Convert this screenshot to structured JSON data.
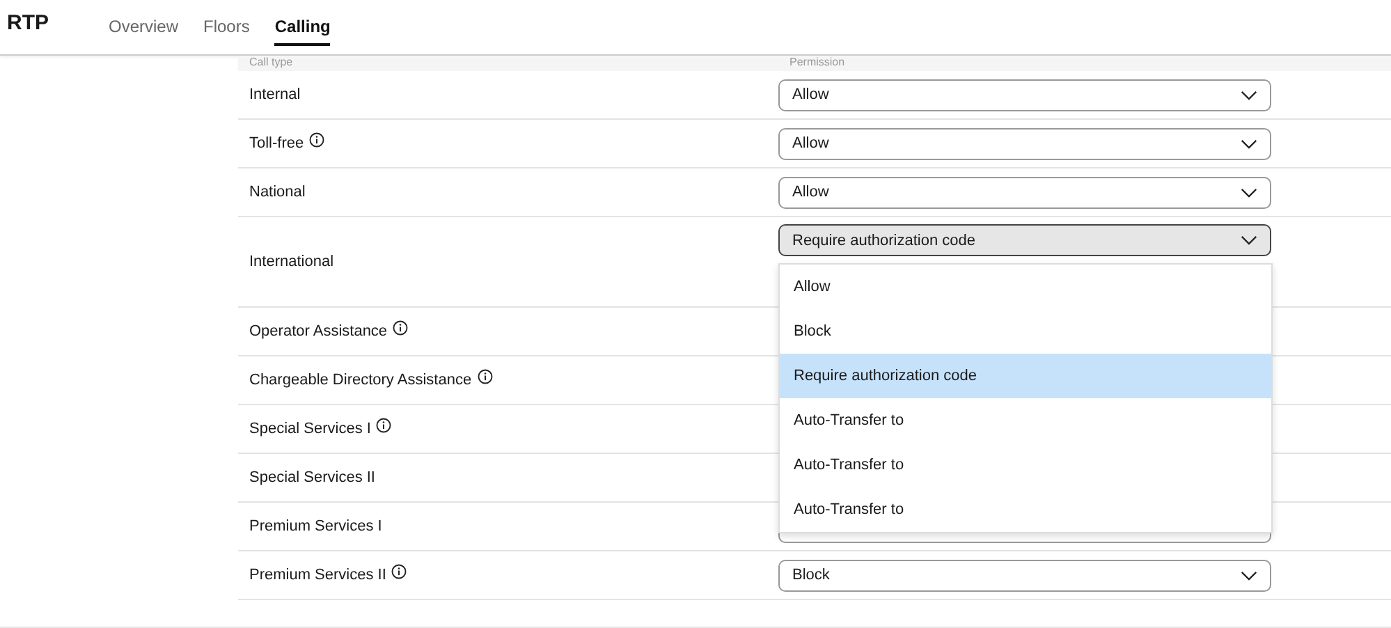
{
  "header": {
    "title": "RTP",
    "tabs": [
      {
        "label": "Overview",
        "selected": false
      },
      {
        "label": "Floors",
        "selected": false
      },
      {
        "label": "Calling",
        "selected": true
      }
    ]
  },
  "table": {
    "columns": [
      "Call type",
      "Permission"
    ],
    "rows": [
      {
        "call_type": "Internal",
        "info": false,
        "permission": "Allow"
      },
      {
        "call_type": "Toll-free",
        "info": true,
        "permission": "Allow"
      },
      {
        "call_type": "National",
        "info": false,
        "permission": "Allow"
      },
      {
        "call_type": "International",
        "info": false,
        "permission": "Require authorization code",
        "expanded": true,
        "options": [
          {
            "label": "Allow",
            "selected": false
          },
          {
            "label": "Block",
            "selected": false
          },
          {
            "label": "Require authorization code",
            "selected": true
          },
          {
            "label": "Auto-Transfer to",
            "selected": false
          },
          {
            "label": "Auto-Transfer to",
            "selected": false
          },
          {
            "label": "Auto-Transfer to",
            "selected": false
          }
        ]
      },
      {
        "call_type": "Operator Assistance",
        "info": true
      },
      {
        "call_type": "Chargeable Directory Assistance",
        "info": true
      },
      {
        "call_type": "Special Services I",
        "info": true
      },
      {
        "call_type": "Special Services II",
        "info": false
      },
      {
        "call_type": "Premium Services I",
        "info": false
      },
      {
        "call_type": "Premium Services II",
        "info": true,
        "permission": "Block"
      }
    ]
  }
}
